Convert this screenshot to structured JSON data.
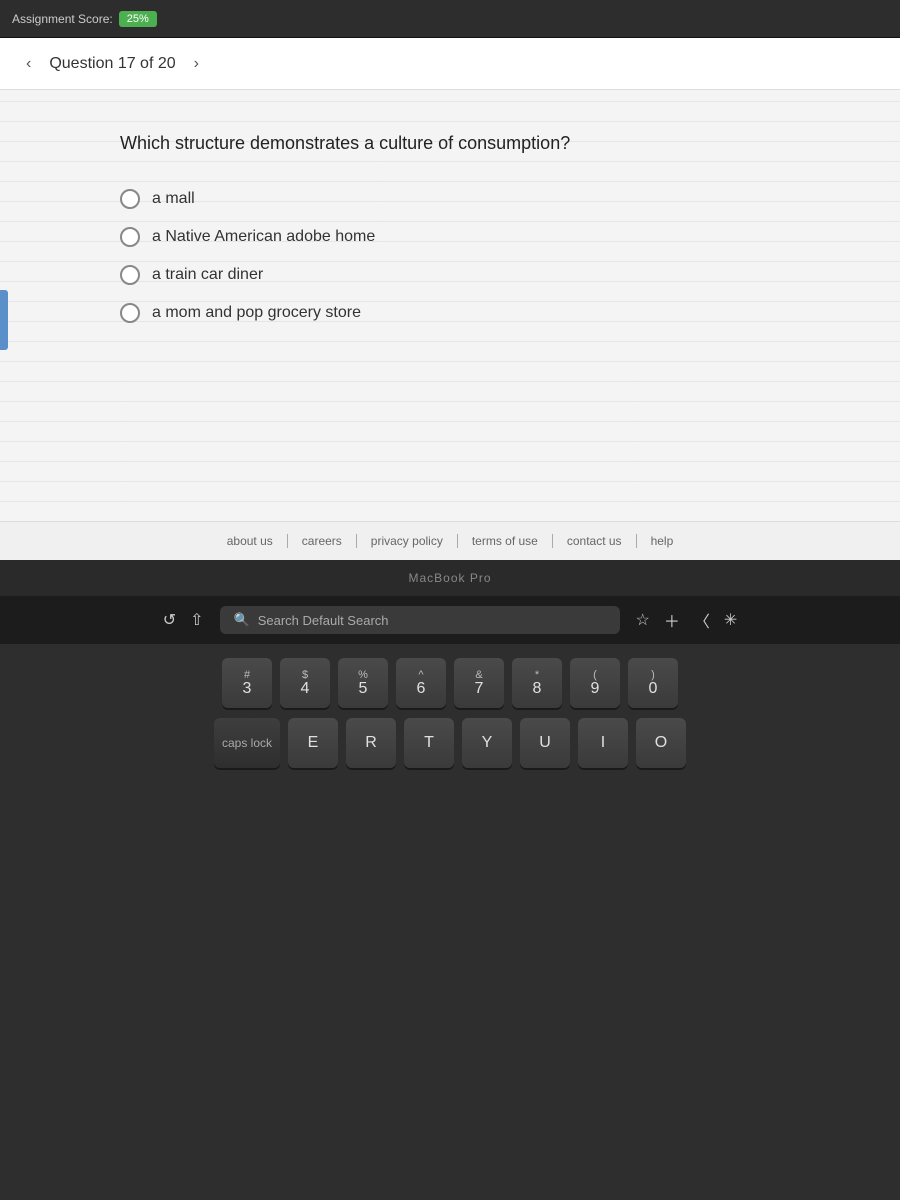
{
  "topbar": {
    "label": "Assignment Score:",
    "badge": "25%"
  },
  "nav": {
    "prev_arrow": "‹",
    "next_arrow": "›",
    "question_label": "Question 17 of 20"
  },
  "question": {
    "text": "Which structure demonstrates a culture of consumption?",
    "options": [
      {
        "id": "opt1",
        "text": "a mall"
      },
      {
        "id": "opt2",
        "text": "a Native American adobe home"
      },
      {
        "id": "opt3",
        "text": "a train car diner"
      },
      {
        "id": "opt4",
        "text": "a mom and pop grocery store"
      }
    ]
  },
  "footer": {
    "links": [
      "about us",
      "careers",
      "privacy policy",
      "terms of use",
      "contact us",
      "help"
    ]
  },
  "macbook": {
    "label": "MacBook Pro"
  },
  "searchbar": {
    "placeholder": "Search Default Search"
  },
  "keyboard": {
    "row1": [
      {
        "top": "#",
        "bot": "3"
      },
      {
        "top": "$",
        "bot": "4"
      },
      {
        "top": "%",
        "bot": "5"
      },
      {
        "top": "^",
        "bot": "6"
      },
      {
        "top": "&",
        "bot": "7"
      },
      {
        "top": "*",
        "bot": "8"
      },
      {
        "top": "(",
        "bot": "9"
      },
      {
        "top": ")",
        "bot": "0"
      }
    ],
    "row2": [
      "E",
      "R",
      "T",
      "Y",
      "U",
      "I",
      "O"
    ]
  },
  "colors": {
    "accent_blue": "#5b8fc9",
    "badge_green": "#4caf50"
  }
}
